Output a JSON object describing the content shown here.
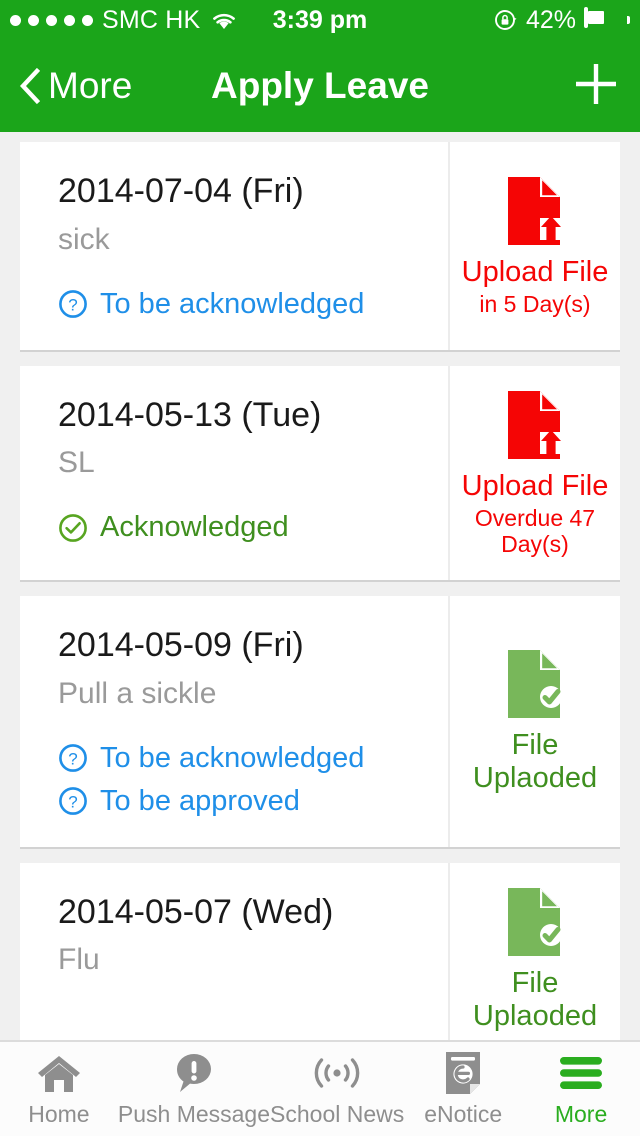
{
  "statusbar": {
    "signal_dots": 5,
    "carrier": "SMC HK",
    "wifi_icon": "wifi-icon",
    "time": "3:39 pm",
    "lock_icon": "rotation-lock-icon",
    "battery_percent": "42%",
    "battery_level": 42
  },
  "navbar": {
    "back_icon": "chevron-left-icon",
    "back_label": "More",
    "title": "Apply Leave",
    "add_icon": "plus-icon"
  },
  "colors": {
    "brand_green": "#1BA51A",
    "accent_red": "#f50505",
    "status_pending_blue": "#1f8fe8",
    "status_done_green": "#3f8f1f",
    "page_background": "#f0f0f0",
    "card_background": "#ffffff"
  },
  "leave_records": [
    {
      "date": "2014-07-04 (Fri)",
      "reason": "sick",
      "statuses": [
        {
          "icon": "question-circle-icon",
          "label": "To be acknowledged",
          "state": "pending"
        }
      ],
      "file": {
        "icon": "file-upload-icon",
        "main": "Upload File",
        "sub": "in 5 Day(s)",
        "state": "red"
      }
    },
    {
      "date": "2014-05-13 (Tue)",
      "reason": "SL",
      "statuses": [
        {
          "icon": "check-circle-icon",
          "label": "Acknowledged",
          "state": "done"
        }
      ],
      "file": {
        "icon": "file-upload-icon",
        "main": "Upload File",
        "sub": "Overdue 47 Day(s)",
        "state": "red"
      }
    },
    {
      "date": "2014-05-09 (Fri)",
      "reason": "Pull a sickle",
      "statuses": [
        {
          "icon": "question-circle-icon",
          "label": "To be acknowledged",
          "state": "pending"
        },
        {
          "icon": "question-circle-icon",
          "label": "To be approved",
          "state": "pending"
        }
      ],
      "file": {
        "icon": "file-check-icon",
        "main": "File Uplaoded",
        "sub": "",
        "state": "green"
      }
    },
    {
      "date": "2014-05-07 (Wed)",
      "reason": "Flu",
      "statuses": [],
      "file": {
        "icon": "file-check-icon",
        "main": "File Uplaoded",
        "sub": "",
        "state": "green"
      }
    }
  ],
  "tabbar": {
    "items": [
      {
        "icon": "home-icon",
        "label": "Home",
        "active": false
      },
      {
        "icon": "push-message-icon",
        "label": "Push Message",
        "active": false
      },
      {
        "icon": "school-news-icon",
        "label": "School News",
        "active": false
      },
      {
        "icon": "enotice-icon",
        "label": "eNotice",
        "active": false
      },
      {
        "icon": "more-hamburger-icon",
        "label": "More",
        "active": true
      }
    ]
  }
}
